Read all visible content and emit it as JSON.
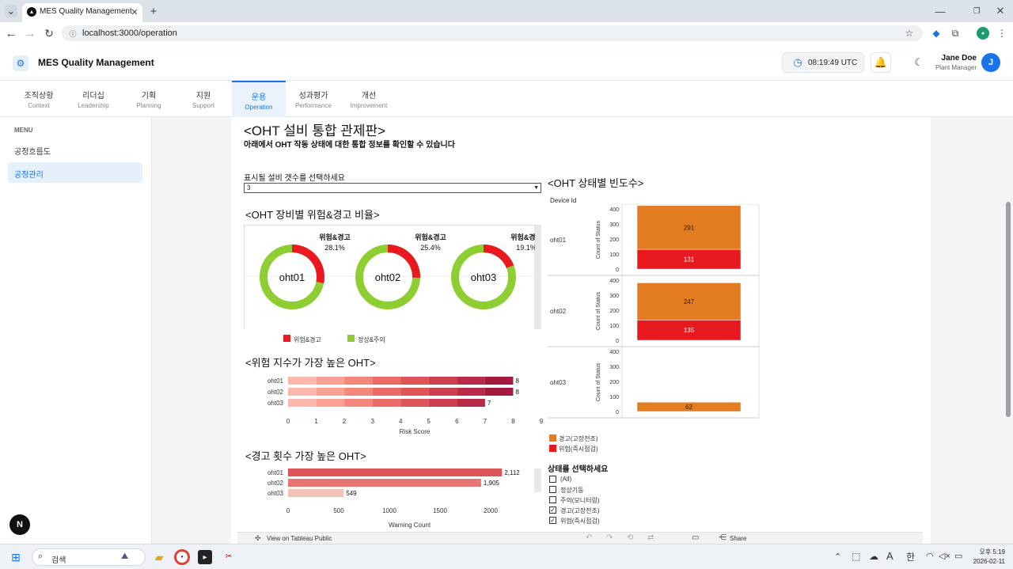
{
  "browser": {
    "tab_title": "MES Quality Management",
    "url": "localhost:3000/operation"
  },
  "app": {
    "title": "MES Quality Management",
    "time": "08:19:49 UTC",
    "user_name": "Jane Doe",
    "user_role": "Plant Manager",
    "avatar_initial": "J"
  },
  "nav": {
    "tabs": [
      {
        "ko": "조직상황",
        "en": "Context"
      },
      {
        "ko": "리더십",
        "en": "Leadership"
      },
      {
        "ko": "기획",
        "en": "Planning"
      },
      {
        "ko": "지원",
        "en": "Support"
      },
      {
        "ko": "운용",
        "en": "Operation"
      },
      {
        "ko": "성과평가",
        "en": "Performance"
      },
      {
        "ko": "개선",
        "en": "Improvement"
      }
    ]
  },
  "sidebar": {
    "heading": "MENU",
    "items": [
      {
        "label": "공정흐름도"
      },
      {
        "label": "공정관리"
      }
    ]
  },
  "dashboard": {
    "title": "<OHT 설비 통합 관제판>",
    "subtitle": "아래에서 OHT 작동 상태에 대한 통합 정보를 확인할 수 있습니다",
    "select_label": "표시될 설비 갯수를 선택하세요",
    "select_value": "3",
    "donut_title": "<OHT 장비별 위험&경고 비율>",
    "legend_risk": "위험&경고",
    "legend_normal": "정상&주의",
    "risk_title": "<위험 지수가 가장 높은 OHT>",
    "risk_xlabel": "Risk Score",
    "warn_title": "<경고 횟수 가장 높은 OHT>",
    "warn_xlabel": "Warning Count",
    "status_title": "<OHT 상태별 빈도수>",
    "status_header": "Device Id",
    "status_ylabel": "Count of Status",
    "status_legend": [
      "경고(고장전조)",
      "위험(즉시점검)"
    ],
    "filter_title": "상태를 선택하세요",
    "filter_options": [
      {
        "label": "(All)",
        "checked": false
      },
      {
        "label": "정상기동",
        "checked": false
      },
      {
        "label": "주의(모니터링)",
        "checked": false
      },
      {
        "label": "경고(고장전조)",
        "checked": true
      },
      {
        "label": "위험(즉시점검)",
        "checked": true
      }
    ],
    "tableau_link": "View on Tableau Public",
    "share": "Share"
  },
  "taskbar": {
    "search": "검색",
    "time": "오후 5:19",
    "date": "2026-02-11",
    "lang": "한",
    "a_icon": "A"
  },
  "colors": {
    "risk_red": "#e8191f",
    "normal_green": "#8fce32",
    "warn_orange": "#e47c22",
    "accent_blue": "#1a73e8"
  },
  "chart_data": [
    {
      "type": "pie",
      "name": "donut",
      "categories": [
        "oht01",
        "oht02",
        "oht03"
      ],
      "series": [
        {
          "name": "위험&경고",
          "values": [
            28.1,
            25.4,
            19.1
          ]
        }
      ],
      "labels": [
        "28.1%",
        "25.4%",
        "19.1%"
      ]
    },
    {
      "type": "bar",
      "name": "risk",
      "categories": [
        "oht01",
        "oht02",
        "oht03"
      ],
      "values": [
        8,
        8,
        7
      ],
      "xlim": [
        0,
        9
      ],
      "ticks": [
        "0",
        "1",
        "2",
        "3",
        "4",
        "5",
        "6",
        "7",
        "8",
        "9"
      ]
    },
    {
      "type": "bar",
      "name": "warning",
      "categories": [
        "oht01",
        "oht02",
        "oht03"
      ],
      "values": [
        2112,
        1905,
        549
      ],
      "value_labels": [
        "2,112",
        "1,905",
        "549"
      ],
      "xlim": [
        0,
        2500
      ],
      "ticks": [
        "0",
        "500",
        "1000",
        "1500",
        "2000"
      ]
    },
    {
      "type": "bar",
      "name": "status",
      "categories": [
        "oht01",
        "oht02",
        "oht03"
      ],
      "ylim": [
        0,
        400
      ],
      "yticks": [
        "400",
        "300",
        "200",
        "100",
        "0"
      ],
      "series": [
        {
          "name": "위험(즉시점검)",
          "values": [
            131,
            135,
            0
          ]
        },
        {
          "name": "경고(고장전조)",
          "values": [
            291,
            247,
            62
          ]
        }
      ]
    }
  ]
}
